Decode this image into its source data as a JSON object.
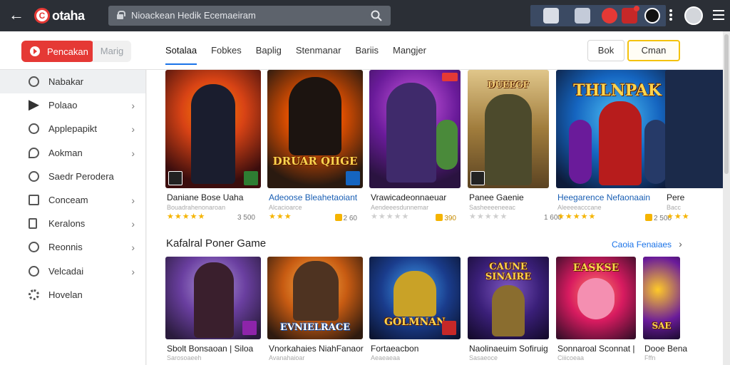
{
  "topbar": {
    "logo_text": "otaha",
    "search_text": "Nioackean Hedik Ecemaeiram",
    "icons": [
      "back-arrow-icon",
      "lock-icon",
      "search-icon",
      "more-vert-icon",
      "avatar",
      "menu-icon"
    ]
  },
  "header": {
    "primary_button": "Pencakan",
    "secondary_button": "Marig",
    "tabs": [
      {
        "label": "Sotalaa",
        "active": true
      },
      {
        "label": "Fobkes",
        "active": false
      },
      {
        "label": "Baplig",
        "active": false
      },
      {
        "label": "Stenmanar",
        "active": false
      },
      {
        "label": "Bariis",
        "active": false
      },
      {
        "label": "Mangjer",
        "active": false
      }
    ],
    "outline_button": "Bok",
    "yellow_button": "Cman"
  },
  "sidebar": {
    "items": [
      {
        "label": "Nabakar",
        "icon": "search-icon",
        "chevron": false,
        "active": true
      },
      {
        "label": "Polaao",
        "icon": "play-icon",
        "chevron": true
      },
      {
        "label": "Applepapikt",
        "icon": "emoji-icon",
        "chevron": true
      },
      {
        "label": "Aokman",
        "icon": "chat-bubble-icon",
        "chevron": true
      },
      {
        "label": "Saedr Perodera",
        "icon": "search-icon",
        "chevron": false
      },
      {
        "label": "Conceam",
        "icon": "folder-icon",
        "chevron": true
      },
      {
        "label": "Keralons",
        "icon": "document-icon",
        "chevron": true
      },
      {
        "label": "Reonnis",
        "icon": "target-icon",
        "chevron": true
      },
      {
        "label": "Velcadai",
        "icon": "gamepad-icon",
        "chevron": true
      },
      {
        "label": "Hovelan",
        "icon": "settings-icon",
        "chevron": false
      }
    ]
  },
  "row1": [
    {
      "title": "Daniane Bose Uaha",
      "sub": "Bouadrahenonaroan",
      "stars": "★★★★★",
      "price": "3 500",
      "coin": false,
      "thumb_text": ""
    },
    {
      "title": "Adeoose Bleahetaoiant",
      "sub": "Alcacioarce",
      "stars": "★★★",
      "price": "2 60",
      "coin": true,
      "thumb_text": "DRUAR QIIGE"
    },
    {
      "title": "Vrawicadeonnaeuar",
      "sub": "Aendeeesdunnemar",
      "stars": "★★★★★",
      "price": "390",
      "coin": true,
      "thumb_text": ""
    },
    {
      "title": "Panee Gaenie",
      "sub": "Sasheeeeneeac",
      "stars": "★★★★★",
      "price": "1 600",
      "coin": false,
      "thumb_text": "DUEEGF"
    },
    {
      "title": "Heegarence Nefaonaain",
      "sub": "Aleeeeacccane",
      "stars": "★★★★★",
      "price": "2 500",
      "coin": true,
      "thumb_text": "THLNPAK"
    },
    {
      "title": "Pere",
      "sub": "Bacc",
      "stars": "★★★",
      "price": "",
      "coin": false,
      "thumb_text": ""
    }
  ],
  "section": {
    "title": "Kafalral Poner Game",
    "link": "Caoia Fenaiaes"
  },
  "row2": [
    {
      "title": "Sbolt Bonsaoan | Siloa",
      "sub": "Sarosoaeeh",
      "thumb_text": ""
    },
    {
      "title": "Vnorkahaies NiahFanaor",
      "sub": "Avanahaioar",
      "thumb_text": "EVNIELRACE"
    },
    {
      "title": "Fortaeacbon",
      "sub": "Aeaeaeaa",
      "thumb_text": "GOLMNAN"
    },
    {
      "title": "Naolinaeuim Sofiruig",
      "sub": "Sasaeoce",
      "thumb_text": "CAUNE SINAIRE"
    },
    {
      "title": "Sonnaroal Sconnat |",
      "sub": "Ciiicoeaa",
      "thumb_text": "EASKSE"
    },
    {
      "title": "Dooe Benaa",
      "sub": "Fffn",
      "thumb_text": "SAE"
    }
  ]
}
